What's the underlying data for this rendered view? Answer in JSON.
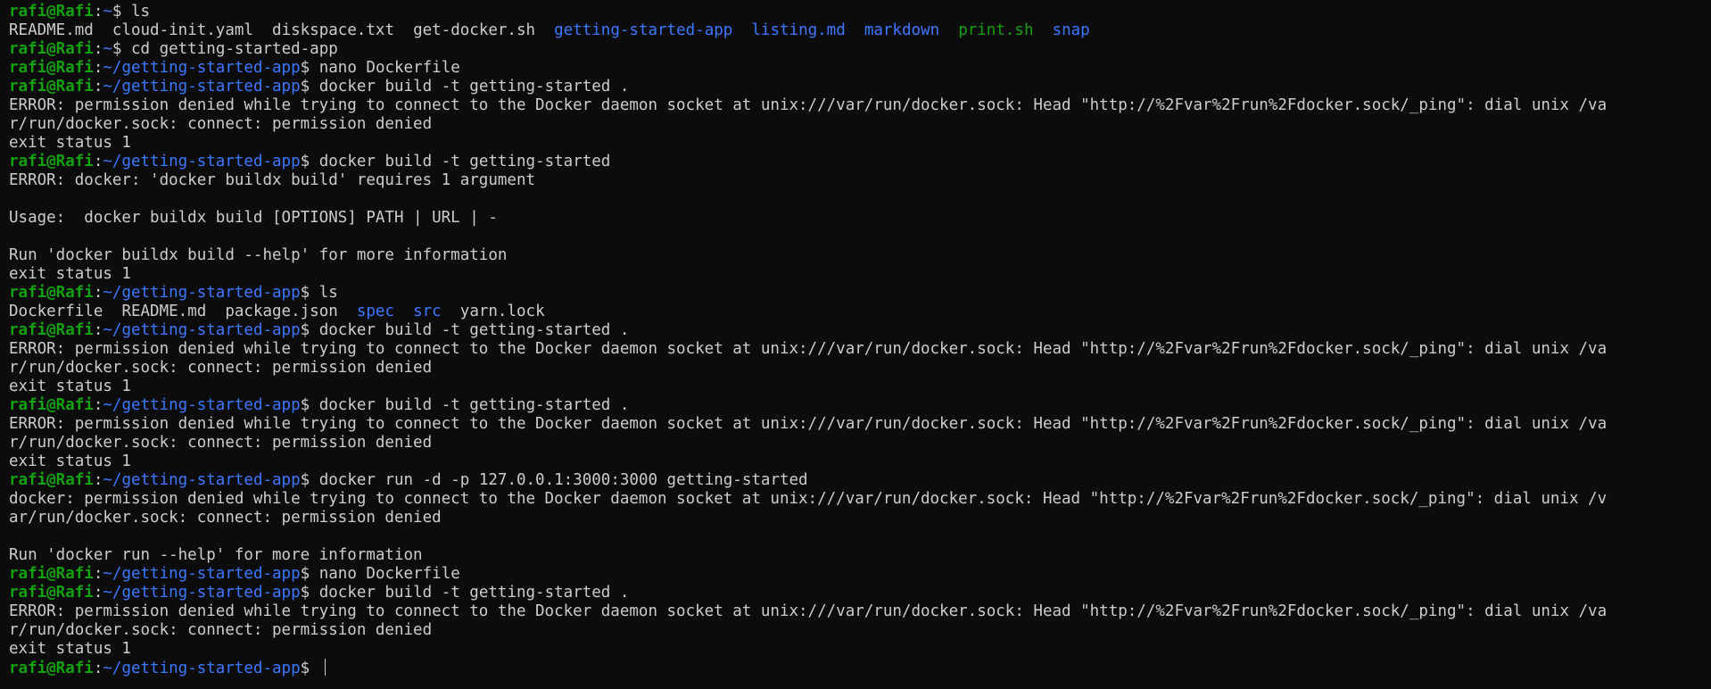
{
  "terminal": {
    "prompt": {
      "user_host": "rafi@Rafi",
      "separator": ":",
      "home_path": "~",
      "app_path": "~/getting-started-app",
      "dollar": "$"
    },
    "lines": [
      {
        "kind": "prompt",
        "path": "~",
        "cmd": " ls"
      },
      {
        "kind": "listing",
        "items": [
          {
            "text": "README.md",
            "type": "file"
          },
          {
            "text": "cloud-init.yaml",
            "type": "file"
          },
          {
            "text": "diskspace.txt",
            "type": "file"
          },
          {
            "text": "get-docker.sh",
            "type": "file"
          },
          {
            "text": "getting-started-app",
            "type": "dir"
          },
          {
            "text": "listing.md",
            "type": "dir"
          },
          {
            "text": "markdown",
            "type": "dir"
          },
          {
            "text": "print.sh",
            "type": "exec"
          },
          {
            "text": "snap",
            "type": "dir"
          }
        ]
      },
      {
        "kind": "prompt",
        "path": "~",
        "cmd": " cd getting-started-app"
      },
      {
        "kind": "prompt",
        "path": "~/getting-started-app",
        "cmd": " nano Dockerfile"
      },
      {
        "kind": "prompt",
        "path": "~/getting-started-app",
        "cmd": " docker build -t getting-started ."
      },
      {
        "kind": "out",
        "text": "ERROR: permission denied while trying to connect to the Docker daemon socket at unix:///var/run/docker.sock: Head \"http://%2Fvar%2Frun%2Fdocker.sock/_ping\": dial unix /va"
      },
      {
        "kind": "out",
        "text": "r/run/docker.sock: connect: permission denied"
      },
      {
        "kind": "out",
        "text": "exit status 1"
      },
      {
        "kind": "prompt",
        "path": "~/getting-started-app",
        "cmd": " docker build -t getting-started"
      },
      {
        "kind": "out",
        "text": "ERROR: docker: 'docker buildx build' requires 1 argument"
      },
      {
        "kind": "out",
        "text": ""
      },
      {
        "kind": "out",
        "text": "Usage:  docker buildx build [OPTIONS] PATH | URL | -"
      },
      {
        "kind": "out",
        "text": ""
      },
      {
        "kind": "out",
        "text": "Run 'docker buildx build --help' for more information"
      },
      {
        "kind": "out",
        "text": "exit status 1"
      },
      {
        "kind": "prompt",
        "path": "~/getting-started-app",
        "cmd": " ls"
      },
      {
        "kind": "listing",
        "items": [
          {
            "text": "Dockerfile",
            "type": "file"
          },
          {
            "text": "README.md",
            "type": "file"
          },
          {
            "text": "package.json",
            "type": "file"
          },
          {
            "text": "spec",
            "type": "dir"
          },
          {
            "text": "src",
            "type": "dir"
          },
          {
            "text": "yarn.lock",
            "type": "file"
          }
        ]
      },
      {
        "kind": "prompt",
        "path": "~/getting-started-app",
        "cmd": " docker build -t getting-started ."
      },
      {
        "kind": "out",
        "text": "ERROR: permission denied while trying to connect to the Docker daemon socket at unix:///var/run/docker.sock: Head \"http://%2Fvar%2Frun%2Fdocker.sock/_ping\": dial unix /va"
      },
      {
        "kind": "out",
        "text": "r/run/docker.sock: connect: permission denied"
      },
      {
        "kind": "out",
        "text": "exit status 1"
      },
      {
        "kind": "prompt",
        "path": "~/getting-started-app",
        "cmd": " docker build -t getting-started ."
      },
      {
        "kind": "out",
        "text": "ERROR: permission denied while trying to connect to the Docker daemon socket at unix:///var/run/docker.sock: Head \"http://%2Fvar%2Frun%2Fdocker.sock/_ping\": dial unix /va"
      },
      {
        "kind": "out",
        "text": "r/run/docker.sock: connect: permission denied"
      },
      {
        "kind": "out",
        "text": "exit status 1"
      },
      {
        "kind": "prompt",
        "path": "~/getting-started-app",
        "cmd": " docker run -d -p 127.0.0.1:3000:3000 getting-started"
      },
      {
        "kind": "out",
        "text": "docker: permission denied while trying to connect to the Docker daemon socket at unix:///var/run/docker.sock: Head \"http://%2Fvar%2Frun%2Fdocker.sock/_ping\": dial unix /v"
      },
      {
        "kind": "out",
        "text": "ar/run/docker.sock: connect: permission denied"
      },
      {
        "kind": "out",
        "text": ""
      },
      {
        "kind": "out",
        "text": "Run 'docker run --help' for more information"
      },
      {
        "kind": "prompt",
        "path": "~/getting-started-app",
        "cmd": " nano Dockerfile"
      },
      {
        "kind": "prompt",
        "path": "~/getting-started-app",
        "cmd": " docker build -t getting-started ."
      },
      {
        "kind": "out",
        "text": "ERROR: permission denied while trying to connect to the Docker daemon socket at unix:///var/run/docker.sock: Head \"http://%2Fvar%2Frun%2Fdocker.sock/_ping\": dial unix /va"
      },
      {
        "kind": "out",
        "text": "r/run/docker.sock: connect: permission denied"
      },
      {
        "kind": "out",
        "text": "exit status 1"
      },
      {
        "kind": "active_prompt",
        "path": "~/getting-started-app",
        "cmd": " "
      }
    ],
    "colors": {
      "background": "#0c0c0c",
      "foreground": "#cccccc",
      "user_host": "#13a10e",
      "path": "#3b78ff",
      "directory": "#3b78ff",
      "executable": "#13a10e"
    }
  }
}
